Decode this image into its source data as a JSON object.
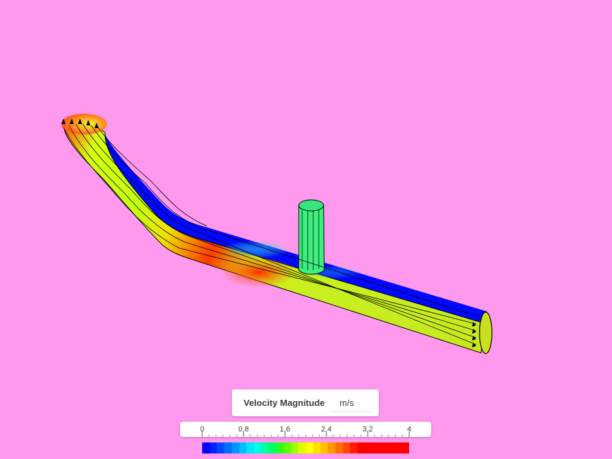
{
  "legend": {
    "title": "Velocity Magnitude",
    "unit": "m/s",
    "ticks": [
      "0",
      "0.8",
      "1.6",
      "2.4",
      "3.2",
      "4"
    ],
    "colors": [
      "#0000ff",
      "#0022ff",
      "#0048ff",
      "#0070ff",
      "#0098ff",
      "#00c0ff",
      "#00e4ff",
      "#00ffe0",
      "#00ffa0",
      "#00ff60",
      "#20ff20",
      "#60ff00",
      "#a0ff00",
      "#d8ff00",
      "#ffff00",
      "#ffe000",
      "#ffc000",
      "#ff9800",
      "#ff7000",
      "#ff4800",
      "#ff2000",
      "#ff0000",
      "#ff0000",
      "#ff0000",
      "#ff0000",
      "#ff0000",
      "#ff0000",
      "#ff0000"
    ]
  },
  "scene": {
    "background": "#ff99ee",
    "wall_color": "#0000ff"
  }
}
